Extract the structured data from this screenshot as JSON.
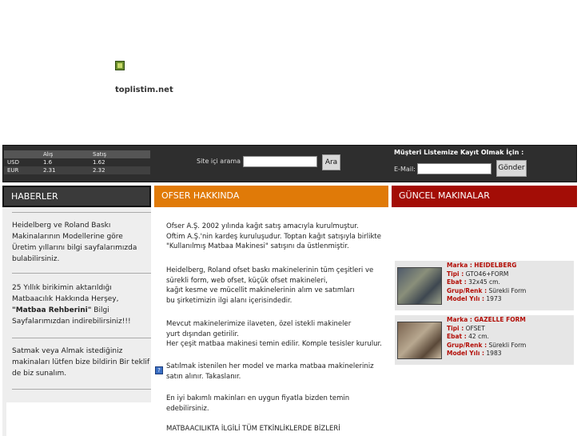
{
  "site": {
    "name": "toplistim.net"
  },
  "currency": {
    "headers": [
      "",
      "Alış",
      "Satış"
    ],
    "rows": [
      {
        "code": "USD",
        "buy": "1.6",
        "sell": "1.62"
      },
      {
        "code": "EUR",
        "buy": "2.31",
        "sell": "2.32"
      }
    ]
  },
  "search": {
    "label": "Site içi arama :",
    "value": "",
    "button": "Ara"
  },
  "register": {
    "title": "Müşteri Listemize Kayıt Olmak İçin :",
    "email_label": "E-Mail:",
    "value": "",
    "button": "Gönder"
  },
  "tabs": {
    "news": "HABERLER",
    "about": "OFSER HAKKINDA",
    "machines": "GÜNCEL MAKINALAR"
  },
  "news": [
    {
      "text": "Heidelberg ve Roland Baskı Makinalarının Modellerine göre Üretim yıllarını bilgi sayfalarımızda bulabilirsiniz."
    },
    {
      "pre": "25 Yıllık birikimin aktarıldığı Matbaacılık Hakkında Herşey,",
      "bold": "\"Matbaa Rehberini\"",
      "post": " Bilgi Sayfalarımızdan indirebilirsiniz!!!"
    },
    {
      "text": "Satmak veya Almak istediğiniz makinaları lütfen bize bildirin Bir teklif de biz sunalım."
    }
  ],
  "about": {
    "p1": [
      "Ofser A.Ş. 2002 yılında kağıt satış amacıyla kurulmuştur.",
      "Oftim A.Ş.'nin kardeş kuruluşudur. Toptan kağıt satışıyla birlikte",
      "\"Kullanılmış Matbaa Makinesi\" satışını da üstlenmiştir."
    ],
    "p2": [
      "Heidelberg, Roland ofset baskı makinelerinin tüm çeşitleri ve",
      "sürekli form, web ofset, küçük ofset makineleri,",
      "kağıt kesme ve mücellit makinelerinin alım ve satımları",
      "bu şirketimizin ilgi alanı içerisindedir."
    ],
    "p3": [
      "Mevcut makinelerimize ilaveten, özel istekli makineler",
      "yurt dışından getirilir.",
      "Her çeşit matbaa makinesi temin edilir. Komple tesisler kurulur."
    ],
    "p4": [
      "Satılmak istenilen her model ve marka matbaa makineleriniz",
      "satın alınır. Takaslanır."
    ],
    "p5": [
      "En iyi bakımlı makinları en uygun fiyatla bizden temin",
      "edebilirsiniz."
    ],
    "p6": [
      "MATBAACILIKTA İLGİLİ TÜM ETKİNLİKLERDE BİZLERİ"
    ]
  },
  "machines": [
    {
      "marka_label": "Marka :",
      "marka": "HEIDELBERG",
      "tip_label": "Tipi :",
      "tip": "GTO46+FORM",
      "ebat_label": "Ebat :",
      "ebat": "32x45 cm.",
      "grup_label": "Grup/Renk :",
      "grup": "Sürekli Form",
      "yil_label": "Model Yılı :",
      "yil": "1973"
    },
    {
      "marka_label": "Marka :",
      "marka": "GAZELLE FORM",
      "tip_label": "Tipi :",
      "tip": "OFSET",
      "ebat_label": "Ebat :",
      "ebat": "42 cm.",
      "grup_label": "Grup/Renk :",
      "grup": "Sürekli Form",
      "yil_label": "Model Yılı :",
      "yil": "1983"
    }
  ],
  "colors": {
    "about_tab": "#e07a08",
    "machines_tab": "#a30d06",
    "topbar": "#2e2e2e"
  }
}
